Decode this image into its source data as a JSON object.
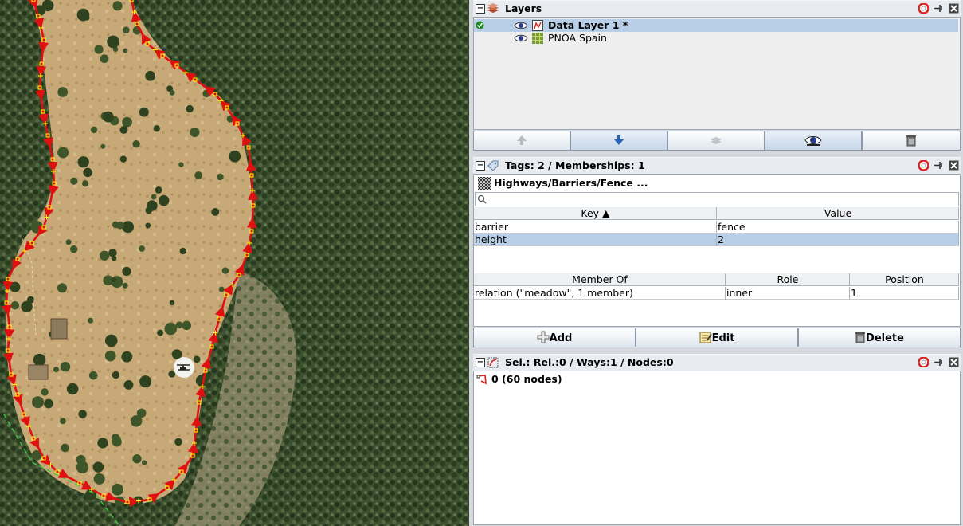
{
  "layers_panel": {
    "title": "Layers",
    "layers": [
      {
        "name": "Data Layer 1 *",
        "active": true,
        "visible": true,
        "icon": "data-layer-icon"
      },
      {
        "name": "PNOA Spain",
        "active": false,
        "visible": true,
        "icon": "imagery-layer-icon"
      }
    ],
    "toolbar": [
      "move-up-icon",
      "move-down-icon",
      "merge-icon",
      "visibility-icon",
      "delete-icon"
    ]
  },
  "tags_panel": {
    "title": "Tags: 2 / Memberships: 1",
    "preset": "Highways/Barriers/Fence ...",
    "search_placeholder": "",
    "headers": {
      "key": "Key ▲",
      "value": "Value"
    },
    "tags": [
      {
        "key": "barrier",
        "value": "fence"
      },
      {
        "key": "height",
        "value": "2"
      }
    ],
    "membership_headers": {
      "member_of": "Member Of",
      "role": "Role",
      "position": "Position"
    },
    "memberships": [
      {
        "member_of": "relation (\"meadow\", 1 member)",
        "role": "inner",
        "position": "1"
      }
    ],
    "buttons": {
      "add": "Add",
      "edit": "Edit",
      "delete": "Delete"
    }
  },
  "selection_panel": {
    "title": "Sel.: Rel.:0 / Ways:1 / Nodes:0",
    "items": [
      {
        "label": "0 (60 nodes)"
      }
    ]
  },
  "colors": {
    "selected_way": "#e01010",
    "node": "#ffff00",
    "selection_row": "#b9cfe8",
    "panel_bg": "#eeeeee"
  }
}
